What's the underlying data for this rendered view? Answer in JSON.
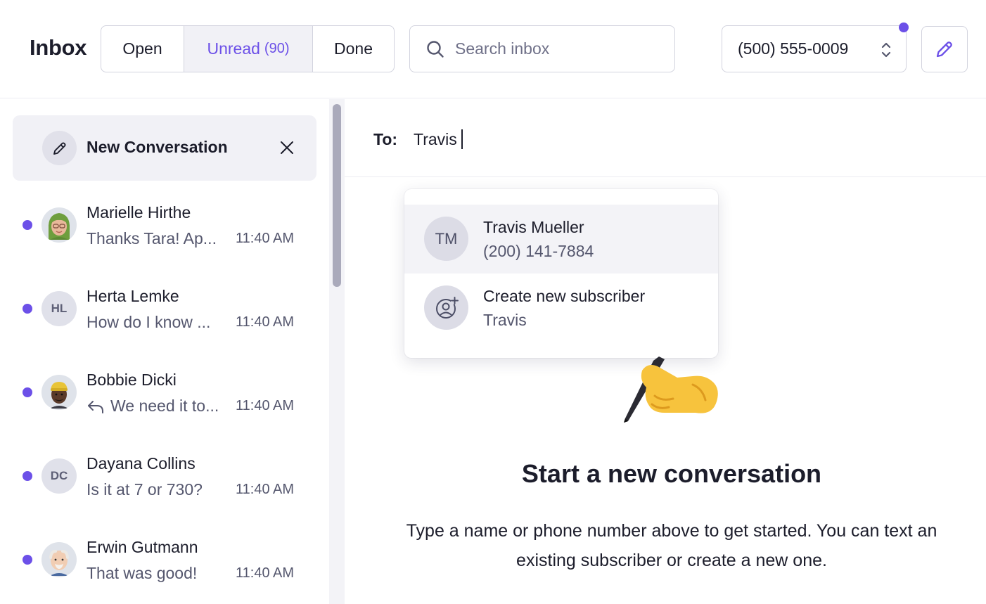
{
  "header": {
    "title": "Inbox",
    "filters": [
      {
        "label": "Open"
      },
      {
        "label": "Unread",
        "count": "(90)"
      },
      {
        "label": "Done"
      }
    ],
    "search": {
      "placeholder": "Search inbox",
      "icon": "search-icon"
    },
    "phone_number": "(500) 555-0009",
    "compose_icon": "pencil-icon"
  },
  "sidebar": {
    "new_conversation": {
      "label": "New Conversation",
      "icon": "pencil-icon",
      "close_icon": "close-icon"
    },
    "conversations": [
      {
        "name": "Marielle Hirthe",
        "preview": "Thanks Tara! Ap...",
        "time": "11:40 AM",
        "avatar": "memoji-woman-green-hair",
        "unread": true
      },
      {
        "name": "Herta Lemke",
        "preview": "How do I know ...",
        "time": "11:40 AM",
        "initials": "HL",
        "unread": true
      },
      {
        "name": "Bobbie Dicki",
        "preview": "We need it to...",
        "time": "11:40 AM",
        "avatar": "memoji-man-yellow-beanie",
        "reply_icon": "reply-icon",
        "unread": true
      },
      {
        "name": "Dayana Collins",
        "preview": "Is it at 7 or 730?",
        "time": "11:40 AM",
        "initials": "DC",
        "unread": true
      },
      {
        "name": "Erwin Gutmann",
        "preview": "That was good!",
        "time": "11:40 AM",
        "avatar": "memoji-old-man",
        "unread": true
      }
    ]
  },
  "compose": {
    "to_label": "To:",
    "to_value": "Travis",
    "suggestions": [
      {
        "initials": "TM",
        "title": "Travis Mueller",
        "subtitle": "(200) 141-7884"
      },
      {
        "icon": "add-user-icon",
        "title": "Create new subscriber",
        "subtitle": "Travis"
      }
    ],
    "empty_state": {
      "emoji": "writing-hand-emoji",
      "title": "Start a new conversation",
      "body": "Type a name or phone number above to get started. You can text an existing subscriber or create a new one."
    }
  },
  "colors": {
    "accent": "#6c50e8",
    "border": "#d2d3de",
    "muted_text": "#55576e",
    "selected_bg": "#f1f1f6"
  }
}
